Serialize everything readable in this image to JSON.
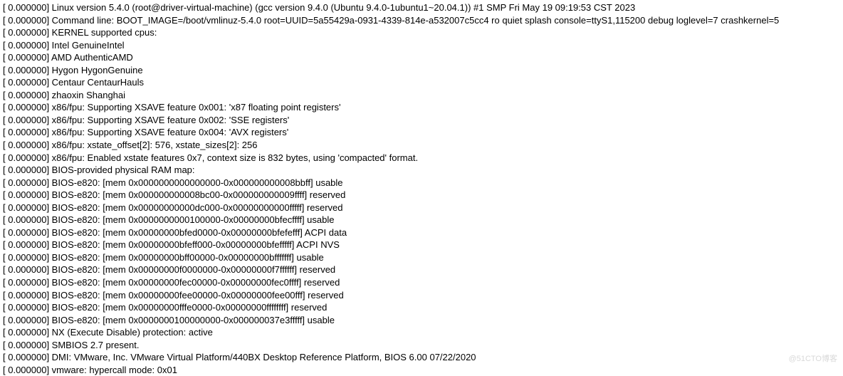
{
  "log": {
    "lines": [
      "[    0.000000] Linux version 5.4.0 (root@driver-virtual-machine) (gcc version 9.4.0 (Ubuntu 9.4.0-1ubuntu1~20.04.1)) #1 SMP Fri May 19 09:19:53 CST 2023",
      "[    0.000000] Command line: BOOT_IMAGE=/boot/vmlinuz-5.4.0 root=UUID=5a55429a-0931-4339-814e-a532007c5cc4 ro quiet splash console=ttyS1,115200 debug loglevel=7 crashkernel=5",
      "[    0.000000] KERNEL supported cpus:",
      "[    0.000000]   Intel GenuineIntel",
      "[    0.000000]   AMD AuthenticAMD",
      "[    0.000000]   Hygon HygonGenuine",
      "[    0.000000]   Centaur CentaurHauls",
      "[    0.000000]   zhaoxin   Shanghai",
      "[    0.000000] x86/fpu: Supporting XSAVE feature 0x001: 'x87 floating point registers'",
      "[    0.000000] x86/fpu: Supporting XSAVE feature 0x002: 'SSE registers'",
      "[    0.000000] x86/fpu: Supporting XSAVE feature 0x004: 'AVX registers'",
      "[    0.000000] x86/fpu: xstate_offset[2]:  576, xstate_sizes[2]:  256",
      "[    0.000000] x86/fpu: Enabled xstate features 0x7, context size is 832 bytes, using 'compacted' format.",
      "[    0.000000] BIOS-provided physical RAM map:",
      "[    0.000000] BIOS-e820: [mem 0x0000000000000000-0x000000000008bbff] usable",
      "[    0.000000] BIOS-e820: [mem 0x000000000008bc00-0x000000000009ffff] reserved",
      "[    0.000000] BIOS-e820: [mem 0x00000000000dc000-0x00000000000fffff] reserved",
      "[    0.000000] BIOS-e820: [mem 0x0000000000100000-0x00000000bfecffff] usable",
      "[    0.000000] BIOS-e820: [mem 0x00000000bfed0000-0x00000000bfefefff] ACPI data",
      "[    0.000000] BIOS-e820: [mem 0x00000000bfeff000-0x00000000bfefffff] ACPI NVS",
      "[    0.000000] BIOS-e820: [mem 0x00000000bff00000-0x00000000bfffffff] usable",
      "[    0.000000] BIOS-e820: [mem 0x00000000f0000000-0x00000000f7ffffff] reserved",
      "[    0.000000] BIOS-e820: [mem 0x00000000fec00000-0x00000000fec0ffff] reserved",
      "[    0.000000] BIOS-e820: [mem 0x00000000fee00000-0x00000000fee00fff] reserved",
      "[    0.000000] BIOS-e820: [mem 0x00000000fffe0000-0x00000000ffffffff] reserved",
      "[    0.000000] BIOS-e820: [mem 0x0000000100000000-0x000000037e3fffff] usable",
      "[    0.000000] NX (Execute Disable) protection: active",
      "[    0.000000] SMBIOS 2.7 present.",
      "[    0.000000] DMI: VMware, Inc. VMware Virtual Platform/440BX Desktop Reference Platform, BIOS 6.00 07/22/2020",
      "[    0.000000] vmware: hypercall mode: 0x01"
    ]
  },
  "watermark": "@51CTO博客"
}
